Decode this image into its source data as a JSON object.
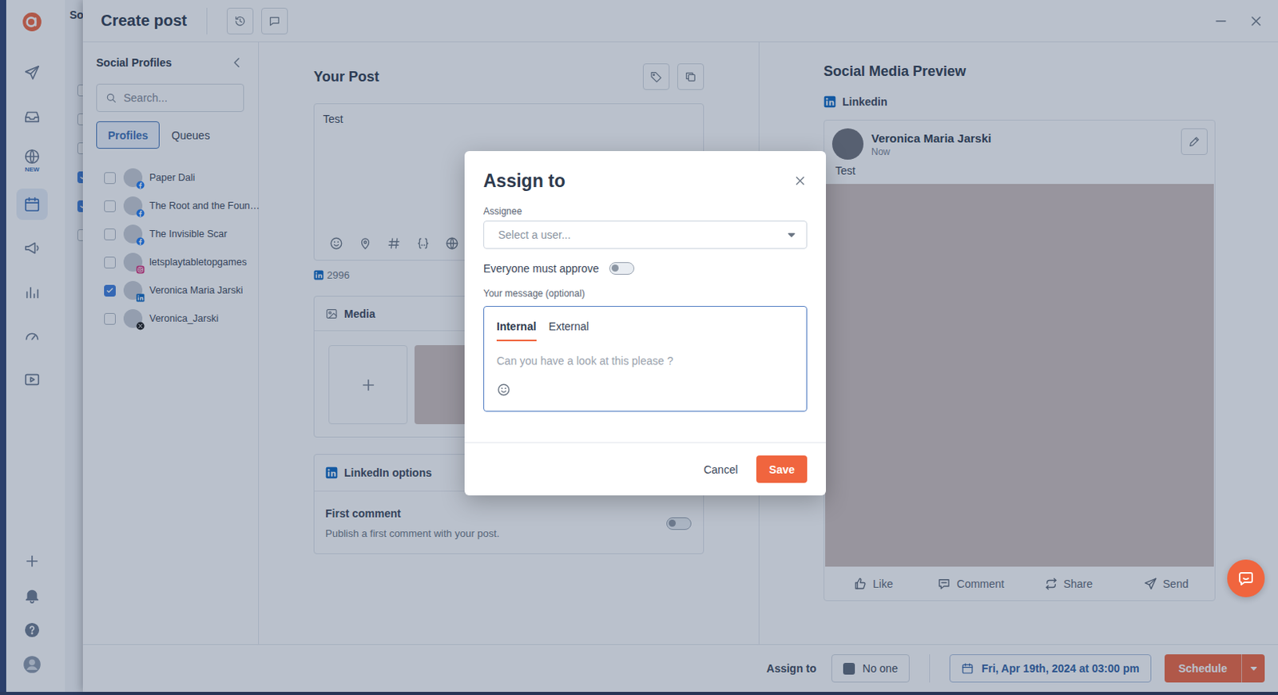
{
  "background_page": {
    "title": "So",
    "checks": [
      {
        "checked": false
      },
      {
        "checked": false
      },
      {
        "checked": false
      },
      {
        "checked": true
      },
      {
        "checked": true
      },
      {
        "checked": false
      }
    ]
  },
  "nav": {
    "top": [
      {
        "selected": false
      },
      {
        "selected": false
      },
      {
        "selected": false
      },
      {
        "selected": false,
        "badge": "NEW"
      },
      {
        "selected": true
      },
      {
        "selected": false
      },
      {
        "selected": false
      },
      {
        "selected": false
      },
      {
        "selected": false
      }
    ],
    "bottom": [
      {
        "selected": false
      },
      {
        "selected": false
      },
      {
        "selected": false
      },
      {
        "selected": false
      }
    ]
  },
  "window": {
    "title": "Create post"
  },
  "profiles": {
    "title": "Social Profiles",
    "search": {
      "placeholder": "Search..."
    },
    "tabs": [
      {
        "label": "Profiles",
        "selected": true
      },
      {
        "label": "Queues",
        "selected": false
      }
    ],
    "items": [
      {
        "name": "Paper Dali",
        "checked": false,
        "kind": "facebook"
      },
      {
        "name": "The Root and the Foun…",
        "checked": false,
        "kind": "facebook"
      },
      {
        "name": "The Invisible Scar",
        "checked": false,
        "kind": "facebook"
      },
      {
        "name": "letsplaytabletopgames",
        "checked": false,
        "kind": "instagram"
      },
      {
        "name": "Veronica Maria Jarski",
        "checked": true,
        "kind": "linkedin"
      },
      {
        "name": "Veronica_Jarski",
        "checked": false,
        "kind": "x"
      }
    ]
  },
  "post": {
    "title": "Your Post",
    "text": "Test",
    "count": "2996"
  },
  "media": {
    "title": "Media"
  },
  "linkedin_options": {
    "title": "LinkedIn options",
    "first_comment": {
      "label": "First comment",
      "description": "Publish a first comment with your post.",
      "on": false
    }
  },
  "preview": {
    "title": "Social Media Preview",
    "network": "Linkedin",
    "author": "Veronica Maria Jarski",
    "time": "Now",
    "text": "Test",
    "actions": [
      "Like",
      "Comment",
      "Share",
      "Send"
    ]
  },
  "footer": {
    "assign_label": "Assign to",
    "assignee": "No one",
    "date": "Fri, Apr 19th, 2024 at 03:00 pm",
    "schedule": "Schedule"
  },
  "dialog": {
    "title": "Assign to",
    "assignee": {
      "label": "Assignee",
      "placeholder": "Select a user..."
    },
    "approve": {
      "label": "Everyone must approve",
      "on": false
    },
    "message": {
      "label": "Your message (optional)",
      "tabs": [
        {
          "label": "Internal",
          "selected": true
        },
        {
          "label": "External",
          "selected": false
        }
      ],
      "placeholder": "Can you have a look at this please ?"
    },
    "buttons": [
      {
        "label": "Cancel",
        "kind": "secondary"
      },
      {
        "label": "Save",
        "kind": "primary"
      }
    ]
  }
}
